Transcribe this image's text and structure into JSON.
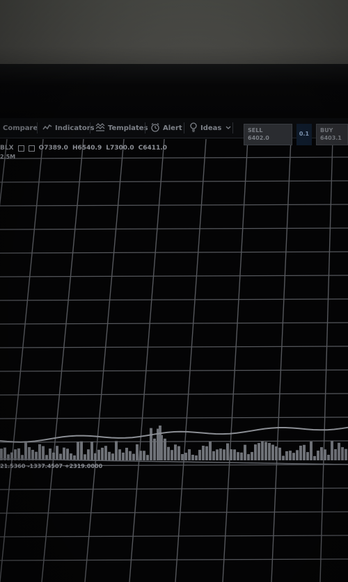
{
  "toolbar": {
    "compare_label": "Compare",
    "indicators_label": "Indicators",
    "templates_label": "Templates",
    "alert_label": "Alert",
    "ideas_label": "Ideas"
  },
  "trade": {
    "sell_label": "SELL",
    "sell_price": "6402.0",
    "quantity": "0.1",
    "buy_label": "BUY",
    "buy_price": "6403.1"
  },
  "legend": {
    "symbol": "BLX",
    "open": "O7389.0",
    "high": "H6540.9",
    "low": "L7300.0",
    "close": "C6411.0",
    "volume": "2.5M"
  },
  "indicator": {
    "values": "21.5360  -1337.4507  +2319.0000"
  },
  "colors": {
    "background": "#030304",
    "grid": "#55575c",
    "price_line": "#8c8f95",
    "volume_bar": "#6e7177",
    "text": "#8e9198"
  }
}
